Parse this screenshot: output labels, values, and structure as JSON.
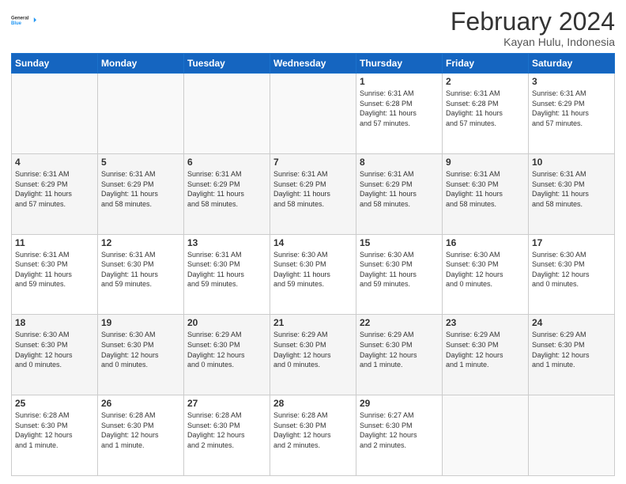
{
  "header": {
    "logo_general": "General",
    "logo_blue": "Blue",
    "month": "February 2024",
    "location": "Kayan Hulu, Indonesia"
  },
  "days_of_week": [
    "Sunday",
    "Monday",
    "Tuesday",
    "Wednesday",
    "Thursday",
    "Friday",
    "Saturday"
  ],
  "weeks": [
    [
      {
        "day": "",
        "info": ""
      },
      {
        "day": "",
        "info": ""
      },
      {
        "day": "",
        "info": ""
      },
      {
        "day": "",
        "info": ""
      },
      {
        "day": "1",
        "info": "Sunrise: 6:31 AM\nSunset: 6:28 PM\nDaylight: 11 hours\nand 57 minutes."
      },
      {
        "day": "2",
        "info": "Sunrise: 6:31 AM\nSunset: 6:28 PM\nDaylight: 11 hours\nand 57 minutes."
      },
      {
        "day": "3",
        "info": "Sunrise: 6:31 AM\nSunset: 6:29 PM\nDaylight: 11 hours\nand 57 minutes."
      }
    ],
    [
      {
        "day": "4",
        "info": "Sunrise: 6:31 AM\nSunset: 6:29 PM\nDaylight: 11 hours\nand 57 minutes."
      },
      {
        "day": "5",
        "info": "Sunrise: 6:31 AM\nSunset: 6:29 PM\nDaylight: 11 hours\nand 58 minutes."
      },
      {
        "day": "6",
        "info": "Sunrise: 6:31 AM\nSunset: 6:29 PM\nDaylight: 11 hours\nand 58 minutes."
      },
      {
        "day": "7",
        "info": "Sunrise: 6:31 AM\nSunset: 6:29 PM\nDaylight: 11 hours\nand 58 minutes."
      },
      {
        "day": "8",
        "info": "Sunrise: 6:31 AM\nSunset: 6:29 PM\nDaylight: 11 hours\nand 58 minutes."
      },
      {
        "day": "9",
        "info": "Sunrise: 6:31 AM\nSunset: 6:30 PM\nDaylight: 11 hours\nand 58 minutes."
      },
      {
        "day": "10",
        "info": "Sunrise: 6:31 AM\nSunset: 6:30 PM\nDaylight: 11 hours\nand 58 minutes."
      }
    ],
    [
      {
        "day": "11",
        "info": "Sunrise: 6:31 AM\nSunset: 6:30 PM\nDaylight: 11 hours\nand 59 minutes."
      },
      {
        "day": "12",
        "info": "Sunrise: 6:31 AM\nSunset: 6:30 PM\nDaylight: 11 hours\nand 59 minutes."
      },
      {
        "day": "13",
        "info": "Sunrise: 6:31 AM\nSunset: 6:30 PM\nDaylight: 11 hours\nand 59 minutes."
      },
      {
        "day": "14",
        "info": "Sunrise: 6:30 AM\nSunset: 6:30 PM\nDaylight: 11 hours\nand 59 minutes."
      },
      {
        "day": "15",
        "info": "Sunrise: 6:30 AM\nSunset: 6:30 PM\nDaylight: 11 hours\nand 59 minutes."
      },
      {
        "day": "16",
        "info": "Sunrise: 6:30 AM\nSunset: 6:30 PM\nDaylight: 12 hours\nand 0 minutes."
      },
      {
        "day": "17",
        "info": "Sunrise: 6:30 AM\nSunset: 6:30 PM\nDaylight: 12 hours\nand 0 minutes."
      }
    ],
    [
      {
        "day": "18",
        "info": "Sunrise: 6:30 AM\nSunset: 6:30 PM\nDaylight: 12 hours\nand 0 minutes."
      },
      {
        "day": "19",
        "info": "Sunrise: 6:30 AM\nSunset: 6:30 PM\nDaylight: 12 hours\nand 0 minutes."
      },
      {
        "day": "20",
        "info": "Sunrise: 6:29 AM\nSunset: 6:30 PM\nDaylight: 12 hours\nand 0 minutes."
      },
      {
        "day": "21",
        "info": "Sunrise: 6:29 AM\nSunset: 6:30 PM\nDaylight: 12 hours\nand 0 minutes."
      },
      {
        "day": "22",
        "info": "Sunrise: 6:29 AM\nSunset: 6:30 PM\nDaylight: 12 hours\nand 1 minute."
      },
      {
        "day": "23",
        "info": "Sunrise: 6:29 AM\nSunset: 6:30 PM\nDaylight: 12 hours\nand 1 minute."
      },
      {
        "day": "24",
        "info": "Sunrise: 6:29 AM\nSunset: 6:30 PM\nDaylight: 12 hours\nand 1 minute."
      }
    ],
    [
      {
        "day": "25",
        "info": "Sunrise: 6:28 AM\nSunset: 6:30 PM\nDaylight: 12 hours\nand 1 minute."
      },
      {
        "day": "26",
        "info": "Sunrise: 6:28 AM\nSunset: 6:30 PM\nDaylight: 12 hours\nand 1 minute."
      },
      {
        "day": "27",
        "info": "Sunrise: 6:28 AM\nSunset: 6:30 PM\nDaylight: 12 hours\nand 2 minutes."
      },
      {
        "day": "28",
        "info": "Sunrise: 6:28 AM\nSunset: 6:30 PM\nDaylight: 12 hours\nand 2 minutes."
      },
      {
        "day": "29",
        "info": "Sunrise: 6:27 AM\nSunset: 6:30 PM\nDaylight: 12 hours\nand 2 minutes."
      },
      {
        "day": "",
        "info": ""
      },
      {
        "day": "",
        "info": ""
      }
    ]
  ]
}
